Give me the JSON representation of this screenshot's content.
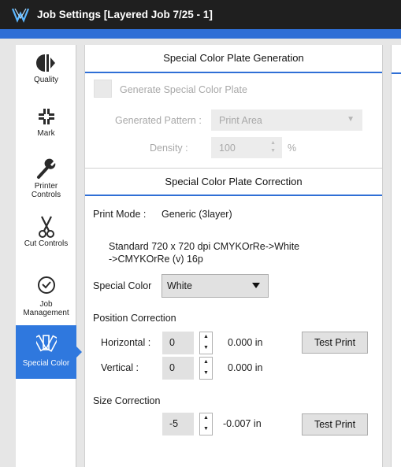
{
  "window": {
    "title": "Job Settings [Layered Job 7/25 - 1]",
    "accent_color": "#2f6fd6",
    "titlebar_color": "#1f1f1f"
  },
  "sidebar": {
    "items": [
      {
        "label": "Quality",
        "icon": "quality-icon"
      },
      {
        "label": "Mark",
        "icon": "mark-icon"
      },
      {
        "label": "Printer Controls",
        "icon": "wrench-icon"
      },
      {
        "label": "Cut Controls",
        "icon": "scissors-icon"
      },
      {
        "label": "Job Management",
        "icon": "clock-icon"
      },
      {
        "label": "Special Color",
        "icon": "special-color-icon",
        "active": true
      }
    ]
  },
  "generation": {
    "header": "Special Color Plate Generation",
    "checkbox_label": "Generate Special Color Plate",
    "pattern_label": "Generated Pattern :",
    "pattern_value": "Print Area",
    "density_label": "Density :",
    "density_value": "100",
    "density_unit": "%"
  },
  "correction": {
    "header": "Special Color Plate Correction",
    "print_mode_label": "Print Mode :",
    "print_mode_value": "Generic (3layer)",
    "mode_description_line1": "Standard 720 x 720 dpi CMYKOrRe->White",
    "mode_description_line2": "->CMYKOrRe (v) 16p",
    "special_color_label": "Special Color",
    "special_color_value": "White",
    "position_correction_label": "Position Correction",
    "horizontal_label": "Horizontal :",
    "horizontal_value": "0",
    "horizontal_readout": "0.000 in",
    "vertical_label": "Vertical :",
    "vertical_value": "0",
    "vertical_readout": "0.000 in",
    "size_correction_label": "Size Correction",
    "size_value": "-5",
    "size_readout": "-0.007 in",
    "test_print_label": "Test Print"
  }
}
